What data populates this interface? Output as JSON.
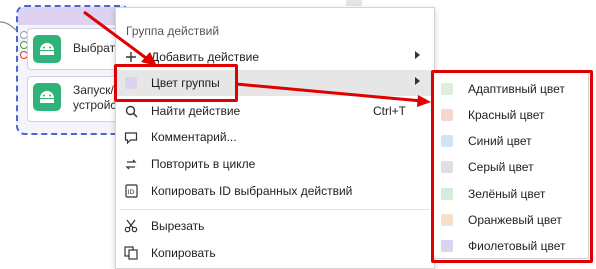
{
  "canvas": {
    "nodes": [
      {
        "text": "Выбрат"
      },
      {
        "text": "Запуск/\nустройс"
      }
    ]
  },
  "menu": {
    "title": "Группа действий",
    "items": [
      {
        "label": "Добавить действие",
        "icon": "plus-icon",
        "shortcut": "",
        "submenu": true
      },
      {
        "label": "Цвет группы",
        "icon": "color-swatch-icon",
        "shortcut": "",
        "submenu": true
      },
      {
        "label": "Найти действие",
        "icon": "search-icon",
        "shortcut": "Ctrl+T",
        "submenu": false
      },
      {
        "label": "Комментарий...",
        "icon": "comment-icon",
        "shortcut": "",
        "submenu": false
      },
      {
        "label": "Повторить в цикле",
        "icon": "loop-icon",
        "shortcut": "",
        "submenu": false
      },
      {
        "label": "Копировать ID выбранных действий",
        "icon": "id-icon",
        "shortcut": "",
        "submenu": false
      },
      {
        "label": "Вырезать",
        "icon": "scissors-icon",
        "shortcut": "",
        "submenu": false
      },
      {
        "label": "Копировать",
        "icon": "copy-icon",
        "shortcut": "",
        "submenu": false
      }
    ]
  },
  "submenu": {
    "items": [
      {
        "label": "Адаптивный цвет",
        "color": "#dcefdc"
      },
      {
        "label": "Красный цвет",
        "color": "#f7d5d2"
      },
      {
        "label": "Синий цвет",
        "color": "#d3e3f7"
      },
      {
        "label": "Серый цвет",
        "color": "#dedfe5"
      },
      {
        "label": "Зелёный цвет",
        "color": "#d4ecd8"
      },
      {
        "label": "Оранжевый цвет",
        "color": "#f5dfc9"
      },
      {
        "label": "Фиолетовый цвет",
        "color": "#ddd2ef"
      }
    ]
  },
  "colors": {
    "annotation": "#e00000",
    "selection_border": "#4a66d6",
    "node_icon": "#2fb37a"
  }
}
